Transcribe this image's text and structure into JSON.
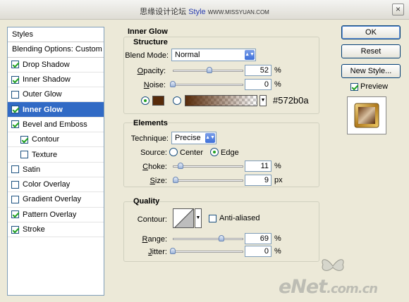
{
  "window": {
    "title_prefix": "思缘设计论坛",
    "title_blue": "Style",
    "title_suffix": "WWW.MISSYUAN.COM",
    "close_glyph": "×"
  },
  "sidebar": {
    "header": "Styles",
    "blending": "Blending Options: Custom",
    "items": [
      {
        "label": "Drop Shadow",
        "checked": true,
        "sub": false,
        "selected": false
      },
      {
        "label": "Inner Shadow",
        "checked": true,
        "sub": false,
        "selected": false
      },
      {
        "label": "Outer Glow",
        "checked": false,
        "sub": false,
        "selected": false
      },
      {
        "label": "Inner Glow",
        "checked": true,
        "sub": false,
        "selected": true
      },
      {
        "label": "Bevel and Emboss",
        "checked": true,
        "sub": false,
        "selected": false
      },
      {
        "label": "Contour",
        "checked": true,
        "sub": true,
        "selected": false
      },
      {
        "label": "Texture",
        "checked": false,
        "sub": true,
        "selected": false
      },
      {
        "label": "Satin",
        "checked": false,
        "sub": false,
        "selected": false
      },
      {
        "label": "Color Overlay",
        "checked": false,
        "sub": false,
        "selected": false
      },
      {
        "label": "Gradient Overlay",
        "checked": false,
        "sub": false,
        "selected": false
      },
      {
        "label": "Pattern Overlay",
        "checked": true,
        "sub": false,
        "selected": false
      },
      {
        "label": "Stroke",
        "checked": true,
        "sub": false,
        "selected": false
      }
    ]
  },
  "inner_glow": {
    "title": "Inner Glow",
    "structure": {
      "title": "Structure",
      "blend_mode_label": "Blend Mode:",
      "blend_mode_value": "Normal",
      "opacity_label": "Opacity:",
      "opacity_value": "52",
      "opacity_fraction": 0.52,
      "noise_label": "Noise:",
      "noise_value": "0",
      "noise_fraction": 0,
      "percent": "%",
      "color_hex": "#572b0a",
      "color_label": "#572b0a"
    },
    "elements": {
      "title": "Elements",
      "technique_label": "Technique:",
      "technique_value": "Precise",
      "source_label": "Source:",
      "source_center": "Center",
      "source_edge": "Edge",
      "choke_label": "Choke:",
      "choke_value": "11",
      "choke_fraction": 0.11,
      "size_label": "Size:",
      "size_value": "9",
      "size_fraction": 0.035,
      "px": "px"
    },
    "quality": {
      "title": "Quality",
      "contour_label": "Contour:",
      "anti_aliased": "Anti-aliased",
      "range_label": "Range:",
      "range_value": "69",
      "range_fraction": 0.69,
      "jitter_label": "Jitter:",
      "jitter_value": "0",
      "jitter_fraction": 0
    }
  },
  "buttons": {
    "ok": "OK",
    "reset": "Reset",
    "new_style": "New Style...",
    "preview": "Preview"
  },
  "watermark": {
    "brand": "eNet",
    "domain": ".com.cn"
  }
}
